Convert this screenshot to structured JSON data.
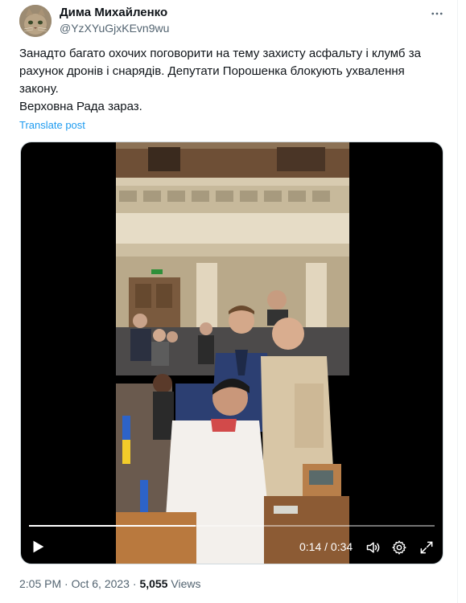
{
  "author": {
    "display_name": "Дима Михайленко",
    "handle": "@YzXYuGjxKEvn9wu",
    "avatar_icon": "cat-avatar"
  },
  "tweet": {
    "lines": [
      "Занадто багато охочих поговорити на тему захисту асфальту і клумб за рахунок дронів і снарядів. Депутати Порошенка блокують ухвалення закону.",
      "Верховна Рада зараз."
    ],
    "translate_label": "Translate post"
  },
  "video": {
    "elapsed": "0:14",
    "separator": "/",
    "duration": "0:34",
    "progress": 0.41,
    "icons": [
      "play-icon",
      "volume-icon",
      "settings-icon",
      "fullscreen-icon"
    ]
  },
  "meta": {
    "time": "2:05 PM",
    "separator": "·",
    "date": "Oct 6, 2023",
    "views_count": "5,055",
    "views_label": "Views"
  },
  "colors": {
    "link": "#1d9bf0",
    "secondary_text": "#536471",
    "primary_text": "#0f1419"
  }
}
